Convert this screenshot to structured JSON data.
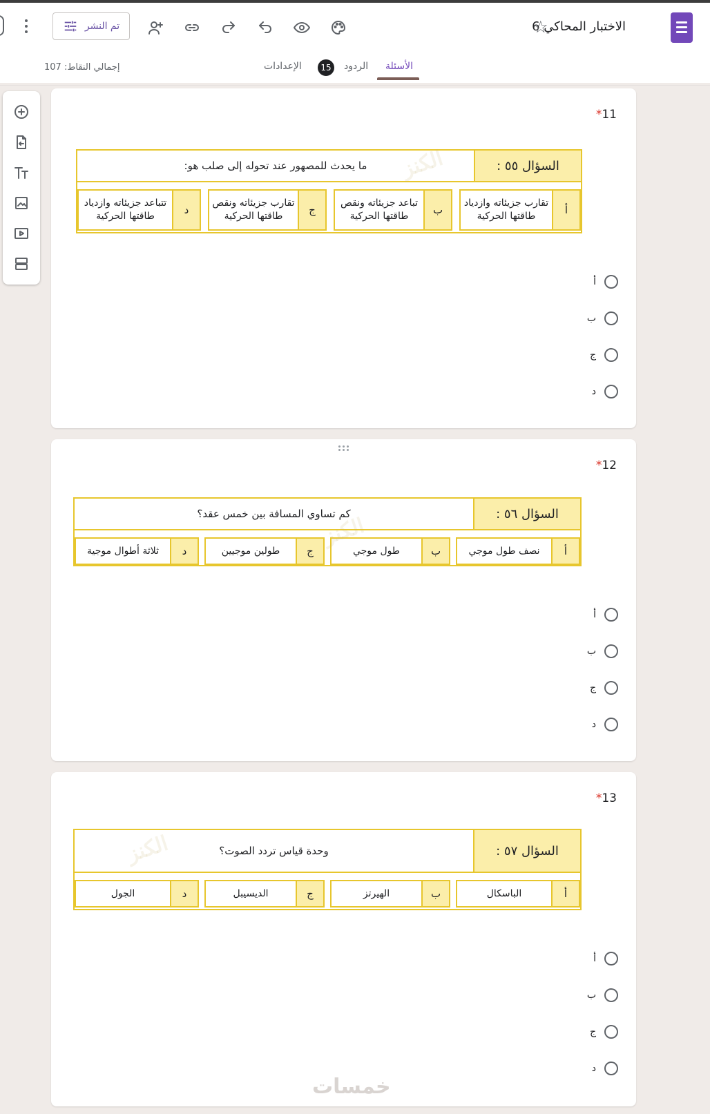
{
  "header": {
    "form_title": "الاختبار المحاكي 6",
    "publish_label": "تم النشر",
    "icons": [
      "form-logo-icon",
      "star-icon",
      "palette-icon",
      "preview-eye-icon",
      "undo-icon",
      "redo-icon",
      "link-icon",
      "add-collaborator-icon",
      "publish-settings-icon",
      "more-vert-icon"
    ]
  },
  "tabs": {
    "questions": "الأسئلة",
    "responses": "الردود",
    "responses_count": "15",
    "settings": "الإعدادات"
  },
  "total_points": "إجمالي النقاط: 107",
  "sidebar": {
    "icons": [
      "add-question-icon",
      "import-questions-icon",
      "add-title-icon",
      "add-image-icon",
      "add-video-icon",
      "add-section-icon"
    ]
  },
  "questions": [
    {
      "number": "11",
      "required": "*",
      "image": {
        "label": "السؤال ٥٥ :",
        "text": "ما يحدث للمصهور عند تحوله إلى صلب هو:",
        "answers": [
          {
            "letter": "أ",
            "text": "تقارب جزيئاته وازدياد طاقتها الحركية"
          },
          {
            "letter": "ب",
            "text": "تباعد جزيئاته ونقص طاقتها الحركية"
          },
          {
            "letter": "ج",
            "text": "تقارب جزيئاته ونقص طاقتها الحركية"
          },
          {
            "letter": "د",
            "text": "تتباعد جزيئاته وازدياد طاقتها الحركية"
          }
        ]
      },
      "options": [
        "أ",
        "ب",
        "ج",
        "د"
      ]
    },
    {
      "number": "12",
      "required": "*",
      "image": {
        "label": "السؤال ٥٦ :",
        "text": "كم تساوي المسافة بين خمس عقد؟",
        "answers": [
          {
            "letter": "أ",
            "text": "نصف طول موجي"
          },
          {
            "letter": "ب",
            "text": "طول موجي"
          },
          {
            "letter": "ج",
            "text": "طولين موجيين"
          },
          {
            "letter": "د",
            "text": "ثلاثة أطوال موجية"
          }
        ]
      },
      "options": [
        "أ",
        "ب",
        "ج",
        "د"
      ]
    },
    {
      "number": "13",
      "required": "*",
      "image": {
        "label": "السؤال ٥٧ :",
        "text": "وحدة قياس تردد الصوت؟",
        "answers": [
          {
            "letter": "أ",
            "text": "الباسكال"
          },
          {
            "letter": "ب",
            "text": "الهيرتز"
          },
          {
            "letter": "ج",
            "text": "الديسيبل"
          },
          {
            "letter": "د",
            "text": "الجول"
          }
        ]
      },
      "options": [
        "أ",
        "ب",
        "ج",
        "د"
      ]
    }
  ],
  "watermarks": {
    "image_mark": "الكنز",
    "site_mark": "خمسات"
  },
  "colors": {
    "accent": "#7248b9",
    "image_border": "#e7c62d",
    "image_label_bg": "#fbeeaa",
    "required": "#d93025"
  }
}
